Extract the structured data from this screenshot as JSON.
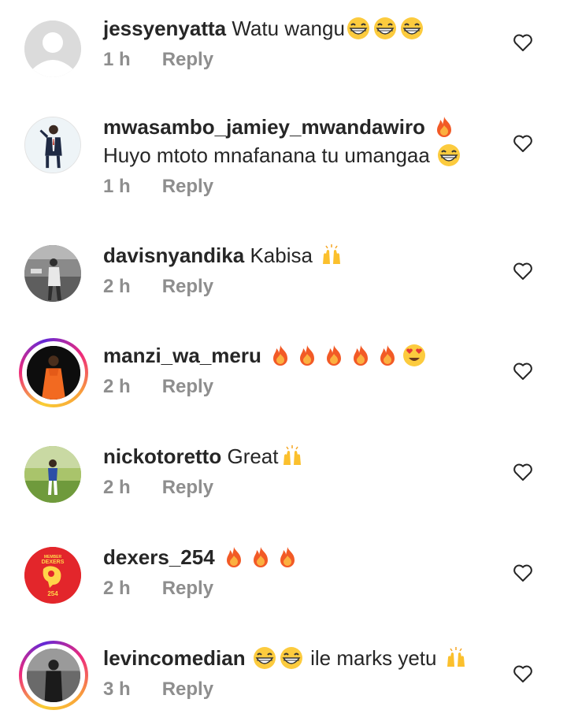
{
  "comments": [
    {
      "username": "jessyenyatta",
      "text": "Watu wangu",
      "emojis_after_text": [
        "grin",
        "grin",
        "grin"
      ],
      "time": "1 h",
      "reply_label": "Reply",
      "avatar": "default-avatar",
      "story_ring": false
    },
    {
      "username": "mwasambo_jamiey_mwandawiro",
      "username_emojis": [
        "fire"
      ],
      "text": "Huyo mtoto mnafanana tu umangaa",
      "emojis_after_text": [
        "grin"
      ],
      "time": "1 h",
      "reply_label": "Reply",
      "avatar": "man-in-suit-avatar",
      "story_ring": false
    },
    {
      "username": "davisnyandika",
      "text": "Kabisa",
      "emojis_after_text": [
        "raised-hands"
      ],
      "time": "2 h",
      "reply_label": "Reply",
      "avatar": "bw-photo-avatar",
      "story_ring": false
    },
    {
      "username": "manzi_wa_meru",
      "text": "",
      "emojis_after_text": [
        "fire",
        "fire",
        "fire",
        "fire",
        "fire",
        "heart-eyes"
      ],
      "time": "2 h",
      "reply_label": "Reply",
      "avatar": "woman-orange-dress-avatar",
      "story_ring": true
    },
    {
      "username": "nickotoretto",
      "text": "Great",
      "emojis_after_text": [
        "raised-hands"
      ],
      "time": "2 h",
      "reply_label": "Reply",
      "avatar": "outdoor-photo-avatar",
      "story_ring": false
    },
    {
      "username": "dexers_254",
      "text": "",
      "emojis_after_text": [
        "fire",
        "fire",
        "fire"
      ],
      "time": "2 h",
      "reply_label": "Reply",
      "avatar": "dexers-logo-avatar",
      "story_ring": false
    },
    {
      "username": "levincomedian",
      "text": "ile marks yetu",
      "emojis_before_text": [
        "grin",
        "grin"
      ],
      "emojis_after_text": [
        "raised-hands"
      ],
      "time": "3 h",
      "reply_label": "Reply",
      "avatar": "bw-man-avatar",
      "story_ring": true
    }
  ],
  "dexers_logo": {
    "top_text": "MEMBER",
    "name": "DEXERS",
    "number": "254"
  },
  "colors": {
    "text": "#262626",
    "muted": "#8e8e8e",
    "dexers_red": "#e3262b"
  }
}
